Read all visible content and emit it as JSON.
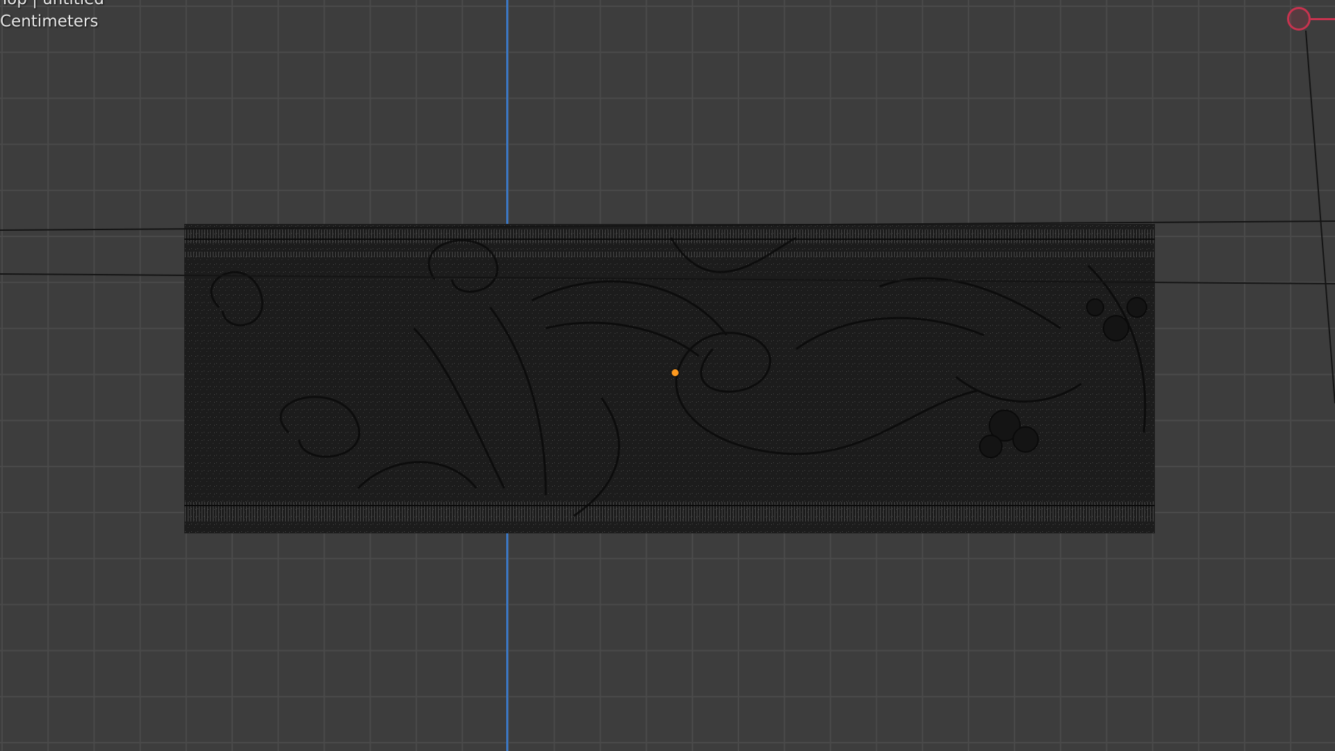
{
  "viewport": {
    "view_title": "Top | untitled",
    "units_label": "Centimeters"
  },
  "colors": {
    "background": "#3d3d3d",
    "grid_line": "#4a4a4a",
    "y_axis": "#3b77c3",
    "x_axis_gizmo": "#c8334f",
    "origin": "#ff9a1f",
    "mesh": "#1c1c1c"
  },
  "icons": {
    "gizmo": "navigation-gizmo-x-axis-icon",
    "origin": "object-origin-icon"
  }
}
